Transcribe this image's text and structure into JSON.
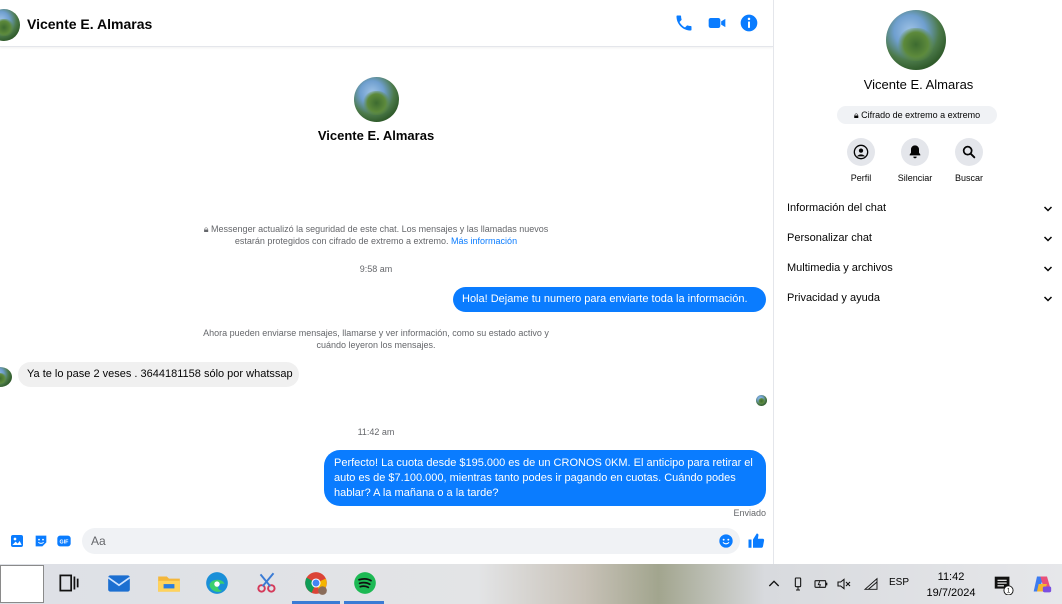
{
  "header": {
    "contact_name": "Vicente E. Almaras"
  },
  "intro": {
    "contact_name": "Vicente E. Almaras"
  },
  "system": {
    "security_notice": "Messenger actualizó la seguridad de este chat. Los mensajes y las llamadas nuevos estarán protegidos con cifrado de extremo a extremo.",
    "security_link": "Más información",
    "time1": "9:58 am",
    "status_notice": "Ahora pueden enviarse mensajes, llamarse y ver información, como su estado activo y cuándo leyeron los mensajes.",
    "time2": "11:42 am"
  },
  "messages": [
    {
      "direction": "out",
      "text": "Hola! Dejame tu numero  para enviarte toda la información."
    },
    {
      "direction": "in",
      "text": "Ya te lo pase 2 veses . 3644181158 sólo por whatssap"
    },
    {
      "direction": "out",
      "text": "Perfecto! La cuota desde $195.000 es de un CRONOS 0KM. El anticipo para retirar el auto es de $7.100.000, mientras tanto podes ir pagando en cuotas. Cuándo podes hablar? A la mañana o a la tarde?"
    }
  ],
  "sent_status": "Enviado",
  "composer": {
    "placeholder": "Aa"
  },
  "side_panel": {
    "contact_name": "Vicente E. Almaras",
    "e2e_badge": "Cifrado de extremo a extremo",
    "actions": [
      {
        "label": "Perfil",
        "icon": "profile-icon"
      },
      {
        "label": "Silenciar",
        "icon": "bell-icon"
      },
      {
        "label": "Buscar",
        "icon": "search-icon"
      }
    ],
    "sections": [
      {
        "label": "Información del chat"
      },
      {
        "label": "Personalizar chat"
      },
      {
        "label": "Multimedia y archivos"
      },
      {
        "label": "Privacidad y ayuda"
      }
    ]
  },
  "taskbar": {
    "language": "ESP",
    "time": "11:42",
    "date": "19/7/2024",
    "notification_count": "1"
  },
  "colors": {
    "accent": "#0a7cff",
    "incoming_bubble": "#f0f0f0"
  }
}
